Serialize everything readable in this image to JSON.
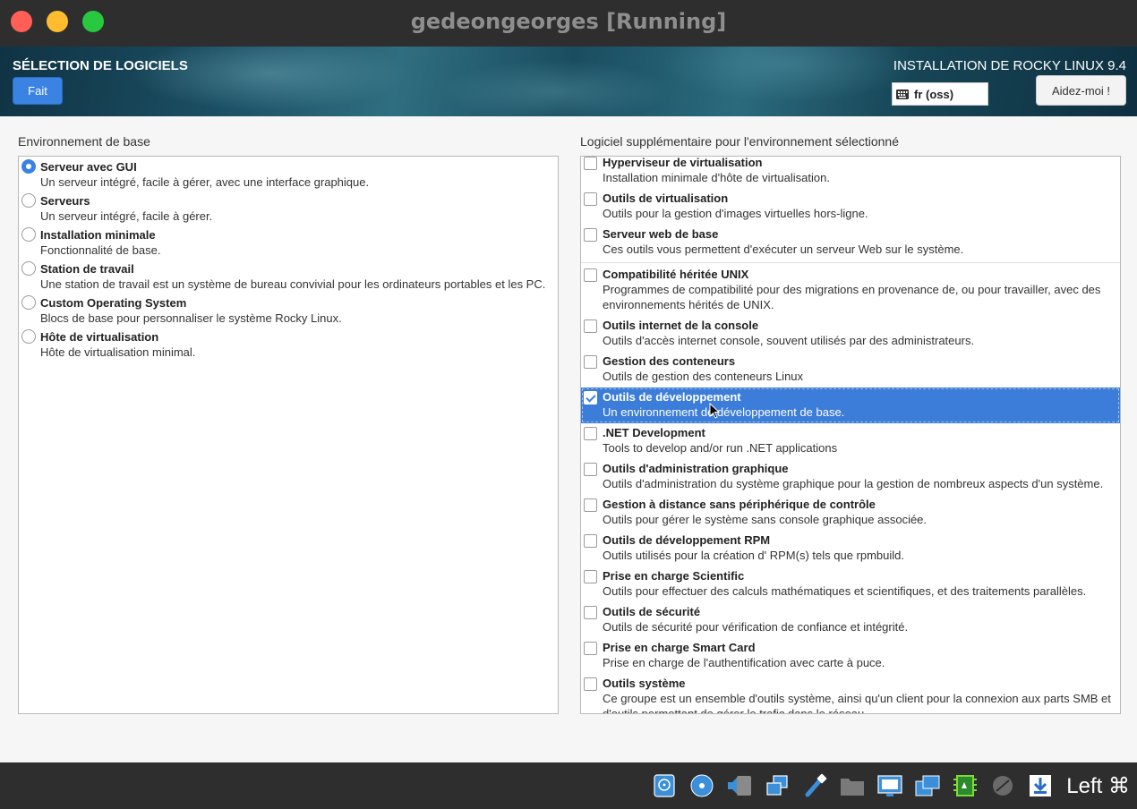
{
  "window": {
    "title": "gedeongeorges [Running]"
  },
  "header": {
    "spoke_title": "SÉLECTION DE LOGICIELS",
    "done_label": "Fait",
    "product_title": "INSTALLATION DE ROCKY LINUX 9.4",
    "keyboard_layout": "fr (oss)",
    "help_label": "Aidez-moi !"
  },
  "base_env": {
    "label": "Environnement de base",
    "items": [
      {
        "name": "Serveur avec GUI",
        "desc": "Un serveur intégré, facile à gérer, avec une interface graphique.",
        "selected": true
      },
      {
        "name": "Serveurs",
        "desc": "Un serveur intégré, facile à gérer.",
        "selected": false
      },
      {
        "name": "Installation minimale",
        "desc": "Fonctionnalité de base.",
        "selected": false
      },
      {
        "name": "Station de travail",
        "desc": "Une station de travail est un système de bureau convivial pour les ordinateurs portables et les PC.",
        "selected": false
      },
      {
        "name": "Custom Operating System",
        "desc": "Blocs de base pour personnaliser le système Rocky Linux.",
        "selected": false
      },
      {
        "name": "Hôte de virtualisation",
        "desc": "Hôte de virtualisation minimal.",
        "selected": false
      }
    ]
  },
  "addons": {
    "label": "Logiciel supplémentaire pour l'environnement sélectionné",
    "items": [
      {
        "name": "Hyperviseur de virtualisation",
        "desc": "Installation minimale d'hôte de virtualisation.",
        "checked": false
      },
      {
        "name": "Outils de virtualisation",
        "desc": "Outils pour la gestion d'images virtuelles hors-ligne.",
        "checked": false
      },
      {
        "name": "Serveur web de base",
        "desc": "Ces outils vous permettent d'exécuter un serveur Web sur le système.",
        "checked": false
      },
      {
        "name": "Compatibilité héritée UNIX",
        "desc": "Programmes de compatibilité pour des migrations en provenance de, ou pour travailler, avec des environnements hérités de UNIX.",
        "checked": false
      },
      {
        "name": "Outils internet de la console",
        "desc": "Outils d'accès internet console, souvent utilisés par des administrateurs.",
        "checked": false
      },
      {
        "name": "Gestion des conteneurs",
        "desc": "Outils de gestion des conteneurs Linux",
        "checked": false
      },
      {
        "name": "Outils de développement",
        "desc": "Un environnement de développement de base.",
        "checked": true
      },
      {
        "name": ".NET Development",
        "desc": "Tools to develop and/or run .NET applications",
        "checked": false
      },
      {
        "name": "Outils d'administration graphique",
        "desc": "Outils d'administration du système graphique pour la gestion de nombreux aspects d'un système.",
        "checked": false
      },
      {
        "name": "Gestion à distance sans périphérique de contrôle",
        "desc": "Outils pour gérer le système sans console graphique associée.",
        "checked": false
      },
      {
        "name": "Outils de développement RPM",
        "desc": "Outils utilisés pour la création d' RPM(s) tels que rpmbuild.",
        "checked": false
      },
      {
        "name": "Prise en charge Scientific",
        "desc": "Outils pour effectuer des calculs mathématiques et scientifiques, et des traitements parallèles.",
        "checked": false
      },
      {
        "name": "Outils de sécurité",
        "desc": "Outils de sécurité pour vérification de confiance et intégrité.",
        "checked": false
      },
      {
        "name": "Prise en charge Smart Card",
        "desc": "Prise en charge de l'authentification avec carte à puce.",
        "checked": false
      },
      {
        "name": "Outils système",
        "desc": "Ce groupe est un ensemble d'outils système, ainsi qu'un client pour la connexion aux parts SMB et d'outils permettant de gérer le trafic dans le réseau.",
        "checked": false
      }
    ]
  },
  "statusbar": {
    "icons": [
      "hard-disk-icon",
      "optical-disk-icon",
      "audio-icon",
      "network-icon",
      "usb-icon",
      "shared-folder-icon",
      "display-icon",
      "recording-icon",
      "cpu-icon",
      "mouse-integration-icon",
      "download-icon"
    ],
    "host_key": "Left ⌘"
  }
}
